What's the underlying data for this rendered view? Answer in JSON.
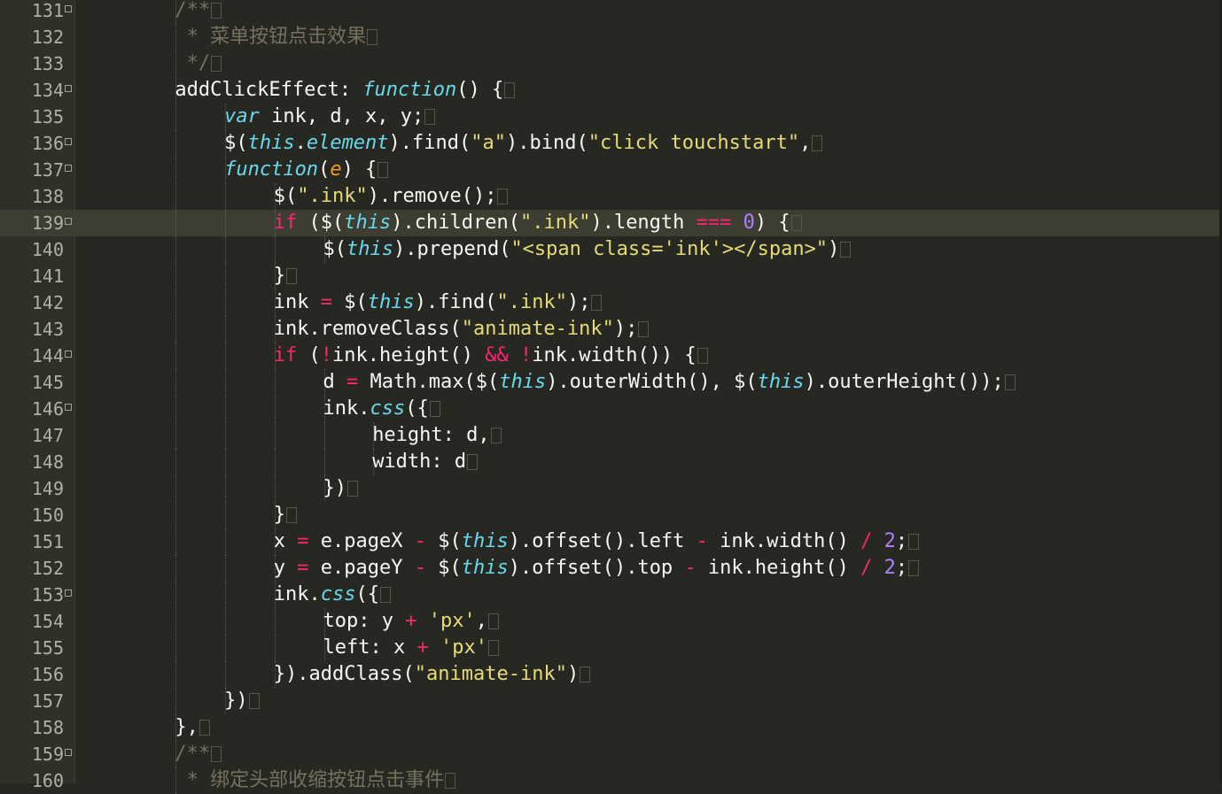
{
  "editor": {
    "theme": "monokai",
    "colors": {
      "background": "#272822",
      "comment": "#75715e",
      "keyword": "#f92672",
      "storage": "#66d9ef",
      "string": "#e6db74",
      "number": "#ae81ff",
      "parameter": "#fd971f",
      "plain": "#f8f8f2"
    },
    "current_line": 139,
    "lines": [
      {
        "num": "131",
        "fold": true,
        "indent": 2,
        "tokens": [
          [
            "c",
            "/**"
          ]
        ]
      },
      {
        "num": "132",
        "fold": false,
        "indent": 2,
        "tokens": [
          [
            "c",
            " * 菜单按钮点击效果"
          ]
        ]
      },
      {
        "num": "133",
        "fold": false,
        "indent": 2,
        "tokens": [
          [
            "c",
            " */"
          ]
        ]
      },
      {
        "num": "134",
        "fold": true,
        "indent": 2,
        "tokens": [
          [
            "p",
            "addClickEffect: "
          ],
          [
            "s",
            "function"
          ],
          [
            "p",
            "() {"
          ]
        ]
      },
      {
        "num": "135",
        "fold": false,
        "indent": 3,
        "tokens": [
          [
            "s",
            "var"
          ],
          [
            "p",
            " ink, d, x, y;"
          ]
        ]
      },
      {
        "num": "136",
        "fold": true,
        "indent": 3,
        "tokens": [
          [
            "p",
            "$("
          ],
          [
            "t",
            "this"
          ],
          [
            "p",
            "."
          ],
          [
            "r",
            "element"
          ],
          [
            "p",
            ").find("
          ],
          [
            "q",
            "\"a\""
          ],
          [
            "p",
            ").bind("
          ],
          [
            "q",
            "\"click touchstart\""
          ],
          [
            "p",
            ","
          ]
        ]
      },
      {
        "num": "137",
        "fold": true,
        "indent": 3,
        "tokens": [
          [
            "s",
            "function"
          ],
          [
            "p",
            "("
          ],
          [
            "a",
            "e"
          ],
          [
            "p",
            ") {"
          ]
        ]
      },
      {
        "num": "138",
        "fold": false,
        "indent": 4,
        "tokens": [
          [
            "p",
            "$("
          ],
          [
            "q",
            "\".ink\""
          ],
          [
            "p",
            ").remove();"
          ]
        ]
      },
      {
        "num": "139",
        "fold": true,
        "indent": 4,
        "tokens": [
          [
            "k",
            "if"
          ],
          [
            "p",
            " ($("
          ],
          [
            "t",
            "this"
          ],
          [
            "p",
            ").children("
          ],
          [
            "q",
            "\".ink\""
          ],
          [
            "p",
            ").length "
          ],
          [
            "o",
            "==="
          ],
          [
            "p",
            " "
          ],
          [
            "n",
            "0"
          ],
          [
            "p",
            ") {"
          ]
        ]
      },
      {
        "num": "140",
        "fold": false,
        "indent": 5,
        "tokens": [
          [
            "p",
            "$("
          ],
          [
            "t",
            "this"
          ],
          [
            "p",
            ").prepend("
          ],
          [
            "q",
            "\"<span class='ink'></span>\""
          ],
          [
            "p",
            ")"
          ]
        ]
      },
      {
        "num": "141",
        "fold": false,
        "indent": 4,
        "tokens": [
          [
            "p",
            "}"
          ]
        ]
      },
      {
        "num": "142",
        "fold": false,
        "indent": 4,
        "tokens": [
          [
            "p",
            "ink "
          ],
          [
            "o",
            "="
          ],
          [
            "p",
            " $("
          ],
          [
            "t",
            "this"
          ],
          [
            "p",
            ").find("
          ],
          [
            "q",
            "\".ink\""
          ],
          [
            "p",
            ");"
          ]
        ]
      },
      {
        "num": "143",
        "fold": false,
        "indent": 4,
        "tokens": [
          [
            "p",
            "ink.removeClass("
          ],
          [
            "q",
            "\"animate-ink\""
          ],
          [
            "p",
            ");"
          ]
        ]
      },
      {
        "num": "144",
        "fold": true,
        "indent": 4,
        "tokens": [
          [
            "k",
            "if"
          ],
          [
            "p",
            " ("
          ],
          [
            "o",
            "!"
          ],
          [
            "p",
            "ink.height() "
          ],
          [
            "o",
            "&&"
          ],
          [
            "p",
            " "
          ],
          [
            "o",
            "!"
          ],
          [
            "p",
            "ink.width()) {"
          ]
        ]
      },
      {
        "num": "145",
        "fold": false,
        "indent": 5,
        "tokens": [
          [
            "p",
            "d "
          ],
          [
            "o",
            "="
          ],
          [
            "p",
            " Math.max($("
          ],
          [
            "t",
            "this"
          ],
          [
            "p",
            ").outerWidth(), $("
          ],
          [
            "t",
            "this"
          ],
          [
            "p",
            ").outerHeight());"
          ]
        ]
      },
      {
        "num": "146",
        "fold": true,
        "indent": 5,
        "tokens": [
          [
            "p",
            "ink."
          ],
          [
            "r",
            "css"
          ],
          [
            "p",
            "({"
          ]
        ]
      },
      {
        "num": "147",
        "fold": false,
        "indent": 6,
        "tokens": [
          [
            "p",
            "height: d,"
          ]
        ]
      },
      {
        "num": "148",
        "fold": false,
        "indent": 6,
        "tokens": [
          [
            "p",
            "width: d"
          ]
        ]
      },
      {
        "num": "149",
        "fold": false,
        "indent": 5,
        "tokens": [
          [
            "p",
            "})"
          ]
        ]
      },
      {
        "num": "150",
        "fold": false,
        "indent": 4,
        "tokens": [
          [
            "p",
            "}"
          ]
        ]
      },
      {
        "num": "151",
        "fold": false,
        "indent": 4,
        "tokens": [
          [
            "p",
            "x "
          ],
          [
            "o",
            "="
          ],
          [
            "p",
            " e.pageX "
          ],
          [
            "o",
            "-"
          ],
          [
            "p",
            " $("
          ],
          [
            "t",
            "this"
          ],
          [
            "p",
            ").offset().left "
          ],
          [
            "o",
            "-"
          ],
          [
            "p",
            " ink.width() "
          ],
          [
            "o",
            "/"
          ],
          [
            "p",
            " "
          ],
          [
            "n",
            "2"
          ],
          [
            "p",
            ";"
          ]
        ]
      },
      {
        "num": "152",
        "fold": false,
        "indent": 4,
        "tokens": [
          [
            "p",
            "y "
          ],
          [
            "o",
            "="
          ],
          [
            "p",
            " e.pageY "
          ],
          [
            "o",
            "-"
          ],
          [
            "p",
            " $("
          ],
          [
            "t",
            "this"
          ],
          [
            "p",
            ").offset().top "
          ],
          [
            "o",
            "-"
          ],
          [
            "p",
            " ink.height() "
          ],
          [
            "o",
            "/"
          ],
          [
            "p",
            " "
          ],
          [
            "n",
            "2"
          ],
          [
            "p",
            ";"
          ]
        ]
      },
      {
        "num": "153",
        "fold": true,
        "indent": 4,
        "tokens": [
          [
            "p",
            "ink."
          ],
          [
            "r",
            "css"
          ],
          [
            "p",
            "({"
          ]
        ]
      },
      {
        "num": "154",
        "fold": false,
        "indent": 5,
        "tokens": [
          [
            "p",
            "top: y "
          ],
          [
            "o",
            "+"
          ],
          [
            "p",
            " "
          ],
          [
            "q",
            "'px'"
          ],
          [
            "p",
            ","
          ]
        ]
      },
      {
        "num": "155",
        "fold": false,
        "indent": 5,
        "tokens": [
          [
            "p",
            "left: x "
          ],
          [
            "o",
            "+"
          ],
          [
            "p",
            " "
          ],
          [
            "q",
            "'px'"
          ]
        ]
      },
      {
        "num": "156",
        "fold": false,
        "indent": 4,
        "tokens": [
          [
            "p",
            "}).addClass("
          ],
          [
            "q",
            "\"animate-ink\""
          ],
          [
            "p",
            ")"
          ]
        ]
      },
      {
        "num": "157",
        "fold": false,
        "indent": 3,
        "tokens": [
          [
            "p",
            "})"
          ]
        ]
      },
      {
        "num": "158",
        "fold": false,
        "indent": 2,
        "tokens": [
          [
            "p",
            "},"
          ]
        ]
      },
      {
        "num": "159",
        "fold": true,
        "indent": 2,
        "tokens": [
          [
            "c",
            "/**"
          ]
        ]
      },
      {
        "num": "160",
        "fold": false,
        "indent": 2,
        "tokens": [
          [
            "c",
            " * 绑定头部收缩按钮点击事件"
          ]
        ]
      }
    ]
  }
}
